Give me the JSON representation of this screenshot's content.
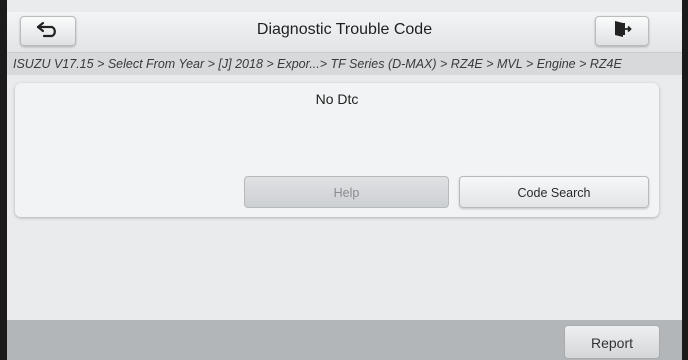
{
  "header": {
    "title": "Diagnostic Trouble Code",
    "back_icon": "back-arrow-icon",
    "exit_icon": "exit-door-icon"
  },
  "breadcrumb": "ISUZU V17.15 > Select From Year > [J] 2018 > Expor...> TF Series (D-MAX) > RZ4E > MVL > Engine > RZ4E",
  "panel": {
    "message": "No Dtc",
    "help_label": "Help",
    "code_search_label": "Code Search"
  },
  "footer": {
    "report_label": "Report"
  }
}
